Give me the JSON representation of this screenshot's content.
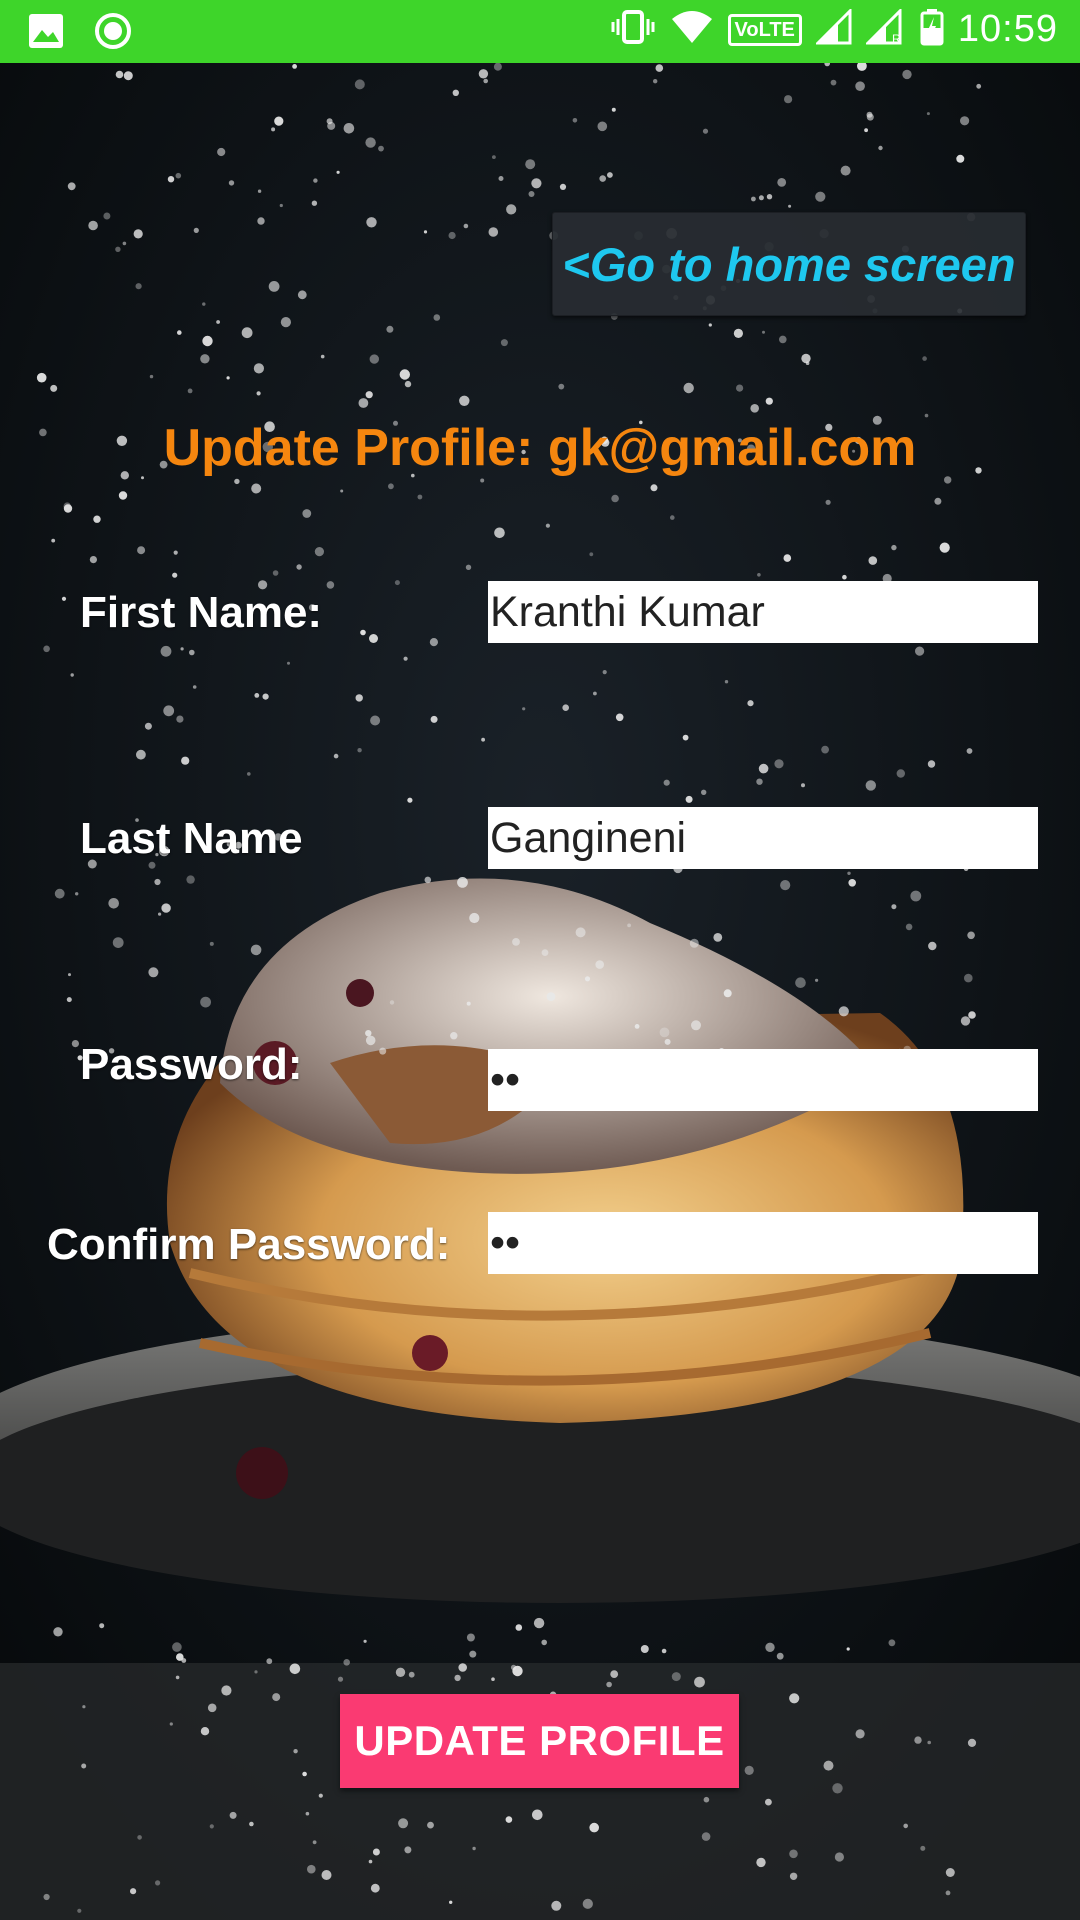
{
  "status_bar": {
    "time": "10:59",
    "volte_label": "VoLTE",
    "left_icons": [
      "image-icon",
      "circle-notification-icon"
    ],
    "right_icons": [
      "vibrate-icon",
      "wifi-icon",
      "volte-icon",
      "signal-icon",
      "signal-roaming-icon",
      "battery-charging-icon"
    ],
    "color": "#3ed52a"
  },
  "header": {
    "home_link": "<Go to home screen",
    "title": "Update Profile: gk@gmail.com"
  },
  "form": {
    "first_name_label": "First Name:",
    "first_name_value": "Kranthi Kumar",
    "last_name_label": "Last Name",
    "last_name_value": "Gangineni",
    "password_label": "Password:",
    "password_value": "••",
    "confirm_password_label": "Confirm Password:",
    "confirm_password_value": "••"
  },
  "actions": {
    "update_button": "UPDATE PROFILE"
  },
  "colors": {
    "title": "#f5860f",
    "home_link": "#1ec8ef",
    "update_button": "#fa3a72"
  }
}
